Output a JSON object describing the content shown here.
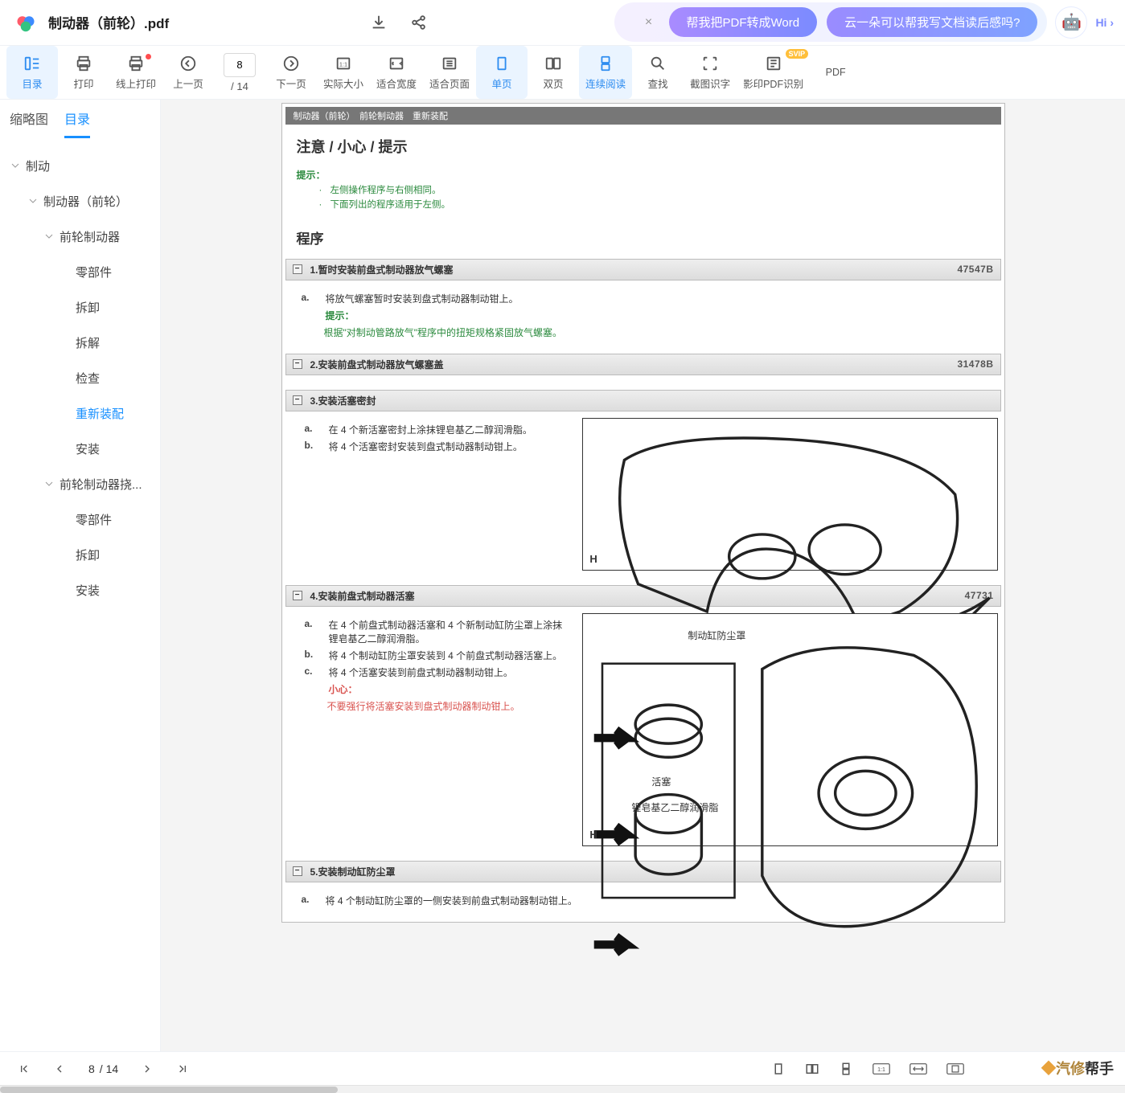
{
  "header": {
    "filename": "制动器（前轮）.pdf",
    "promo1": "帮我把PDF转成Word",
    "promo2": "云一朵可以帮我写文档读后感吗?",
    "hi": "Hi ›"
  },
  "toolbar": {
    "catalog": "目录",
    "print": "打印",
    "online_print": "线上打印",
    "prev": "上一页",
    "next": "下一页",
    "page": "8",
    "total": "/ 14",
    "actual_size": "实际大小",
    "fit_width": "适合宽度",
    "fit_page": "适合页面",
    "single": "单页",
    "double": "双页",
    "continuous": "连续阅读",
    "find": "查找",
    "ocr": "截图识字",
    "photo_ocr": "影印PDF识别",
    "pdf": "PDF",
    "svip": "SVIP"
  },
  "sidebar": {
    "tab_thumb": "缩略图",
    "tab_toc": "目录",
    "tree": {
      "n0": "制动",
      "n1": "制动器（前轮）",
      "n2": "前轮制动器",
      "n2a": "零部件",
      "n2b": "拆卸",
      "n2c": "拆解",
      "n2d": "检查",
      "n2e": "重新装配",
      "n2f": "安装",
      "n3": "前轮制动器挠...",
      "n3a": "零部件",
      "n3b": "拆卸",
      "n3c": "安装"
    }
  },
  "doc": {
    "crumb": "制动器（前轮）　前轮制动器　重新装配",
    "heading": "注意 / 小心 / 提示",
    "hint_label": "提示：",
    "hint1": "左侧操作程序与右侧相同。",
    "hint2": "下面列出的程序适用于左侧。",
    "proc": "程序",
    "s1": {
      "t": "1.暂时安装前盘式制动器放气螺塞",
      "code": "47547B",
      "a": "将放气螺塞暂时安装到盘式制动器制动钳上。",
      "hint": "提示：",
      "hint_body": "根据\"对制动管路放气\"程序中的扭矩规格紧固放气螺塞。"
    },
    "s2": {
      "t": "2.安装前盘式制动器放气螺塞盖",
      "code": "31478B"
    },
    "s3": {
      "t": "3.安装活塞密封",
      "a": "在 4 个新活塞密封上涂抹锂皂基乙二醇润滑脂。",
      "b": "将 4 个活塞密封安装到盘式制动器制动钳上。"
    },
    "s4": {
      "t": "4.安装前盘式制动器活塞",
      "code": "47731",
      "a": "在 4 个前盘式制动器活塞和 4 个新制动缸防尘罩上涂抹锂皂基乙二醇润滑脂。",
      "b": "将 4 个制动缸防尘罩安装到 4 个前盘式制动器活塞上。",
      "c": "将 4 个活塞安装到前盘式制动器制动钳上。",
      "warn": "小心：",
      "warn_body": "不要强行将活塞安装到盘式制动器制动钳上。",
      "lab1": "制动缸防尘罩",
      "lab2": "活塞",
      "lab3": "锂皂基乙二醇润滑脂"
    },
    "s5": {
      "t": "5.安装制动缸防尘罩",
      "a": "将 4 个制动缸防尘罩的一侧安装到前盘式制动器制动钳上。"
    }
  },
  "footer": {
    "page": "8",
    "total": "/ 14",
    "brand_pre": "汽修",
    "brand_post": "帮手"
  }
}
